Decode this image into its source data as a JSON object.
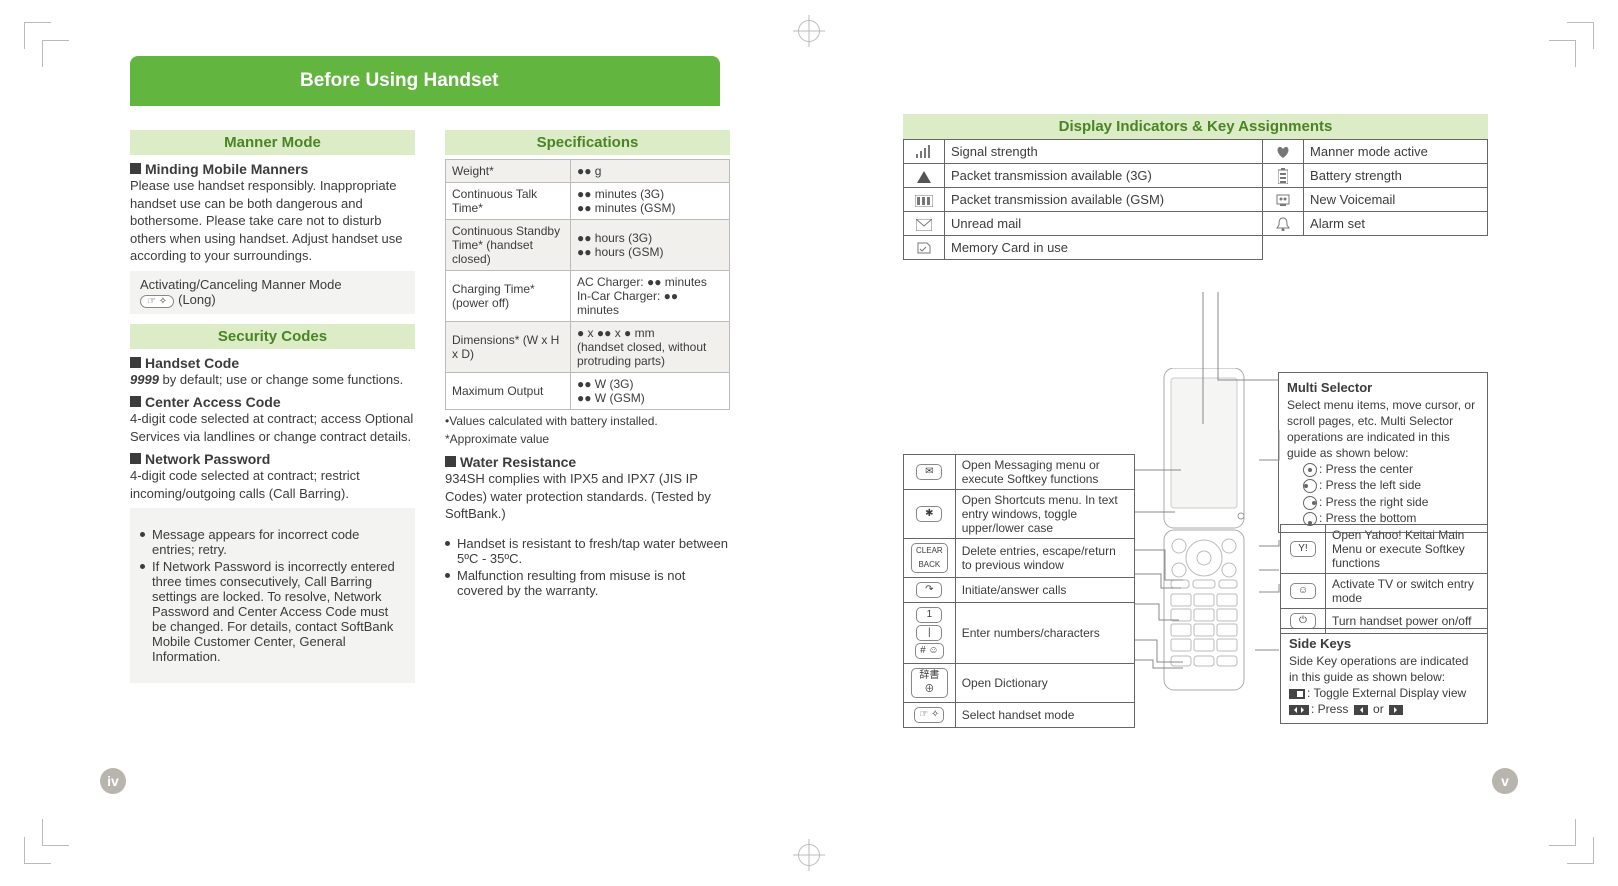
{
  "page": {
    "title": "Before Using Handset",
    "left_num": "iv",
    "right_num": "v"
  },
  "manner": {
    "hd": "Manner Mode",
    "sub": "Minding Mobile Manners",
    "body": "Please use handset responsibly. Inappropriate handset use can be both dangerous and bothersome. Please take care not to disturb others when using handset. Adjust handset use according to your surroundings.",
    "call1": "Activating/Canceling Manner Mode",
    "call2": "(Long)"
  },
  "security": {
    "hd": "Security Codes",
    "h1": "Handset Code",
    "b1_def": "9999",
    "b1": " by default; use or change some functions.",
    "h2": "Center Access Code",
    "b2": "4-digit code selected at contract; access Optional Services via landlines or change contract details.",
    "h3": "Network Password",
    "b3": "4-digit code selected at contract; restrict incoming/outgoing calls (Call Barring).",
    "note1": "Message appears for incorrect code entries; retry.",
    "note2": "If Network Password is incorrectly entered three times consecutively, Call Barring settings are locked. To resolve, Network Password and Center Access Code must be changed. For details, contact SoftBank Mobile Customer Center, General Information."
  },
  "spec": {
    "hd": "Specifications",
    "rows": [
      {
        "l": "Weight*",
        "v": "●● g"
      },
      {
        "l": "Continuous Talk Time*",
        "v": "●● minutes (3G)\n●● minutes (GSM)"
      },
      {
        "l": "Continuous Standby Time* (handset closed)",
        "v": "●● hours (3G)\n●● hours (GSM)"
      },
      {
        "l": "Charging Time* (power off)",
        "v": "AC Charger: ●● minutes\nIn-Car Charger: ●● minutes"
      },
      {
        "l": "Dimensions* (W x H x D)",
        "v": "● x ●● x ● mm\n(handset closed, without protruding parts)"
      },
      {
        "l": "Maximum Output",
        "v": "●● W (3G)\n●● W (GSM)"
      }
    ],
    "foot1": "Values calculated with battery installed.",
    "foot2": "*Approximate value",
    "wr_hd": "Water Resistance",
    "wr_body": "934SH complies with IPX5 and IPX7 (JIS IP Codes) water protection standards. (Tested by SoftBank.)",
    "wr_b1": "Handset is resistant to fresh/tap water between 5ºC - 35ºC.",
    "wr_b2": "Malfunction resulting from misuse is not covered by the warranty."
  },
  "display": {
    "hd": "Display Indicators & Key Assignments",
    "left": [
      {
        "ic": "signal",
        "t": "Signal strength"
      },
      {
        "ic": "tri",
        "t": "Packet transmission available (3G)"
      },
      {
        "ic": "gsm",
        "t": "Packet transmission available (GSM)"
      },
      {
        "ic": "mail",
        "t": "Unread mail"
      },
      {
        "ic": "card",
        "t": "Memory Card in use"
      }
    ],
    "right": [
      {
        "ic": "heart",
        "t": "Manner mode active"
      },
      {
        "ic": "bat",
        "t": "Battery strength"
      },
      {
        "ic": "vm",
        "t": "New Voicemail"
      },
      {
        "ic": "bell",
        "t": "Alarm set"
      }
    ]
  },
  "leftkeys": [
    {
      "k": "msg",
      "t": "Open Messaging menu or execute Softkey functions"
    },
    {
      "k": "short",
      "t": "Open Shortcuts menu. In text entry windows, toggle upper/lower case"
    },
    {
      "k": "clear",
      "t": "Delete entries, escape/return to previous window"
    },
    {
      "k": "call",
      "t": "Initiate/answer calls"
    },
    {
      "k": "num",
      "t": "Enter numbers/characters"
    },
    {
      "k": "dict",
      "t": "Open Dictionary"
    },
    {
      "k": "mode",
      "t": "Select handset mode"
    }
  ],
  "rightkeys": [
    {
      "k": "yahoo",
      "t": "Open Yahoo! Keitai Main Menu or execute Softkey functions"
    },
    {
      "k": "tv",
      "t": "Activate TV or switch entry mode"
    },
    {
      "k": "pwr",
      "t": "Turn handset power on/off"
    }
  ],
  "multi": {
    "ttl": "Multi Selector",
    "body": "Select menu items, move cursor, or scroll pages, etc. Multi Selector operations are indicated in this guide as shown below:",
    "c": ": Press the center",
    "l": ": Press the left side",
    "r": ": Press the right side",
    "b": ": Press the bottom"
  },
  "side": {
    "ttl": "Side Keys",
    "body": "Side Key operations are indicated in this guide as shown below:",
    "a": ": Toggle External Display view",
    "b1": ": Press",
    "b2": "or"
  }
}
